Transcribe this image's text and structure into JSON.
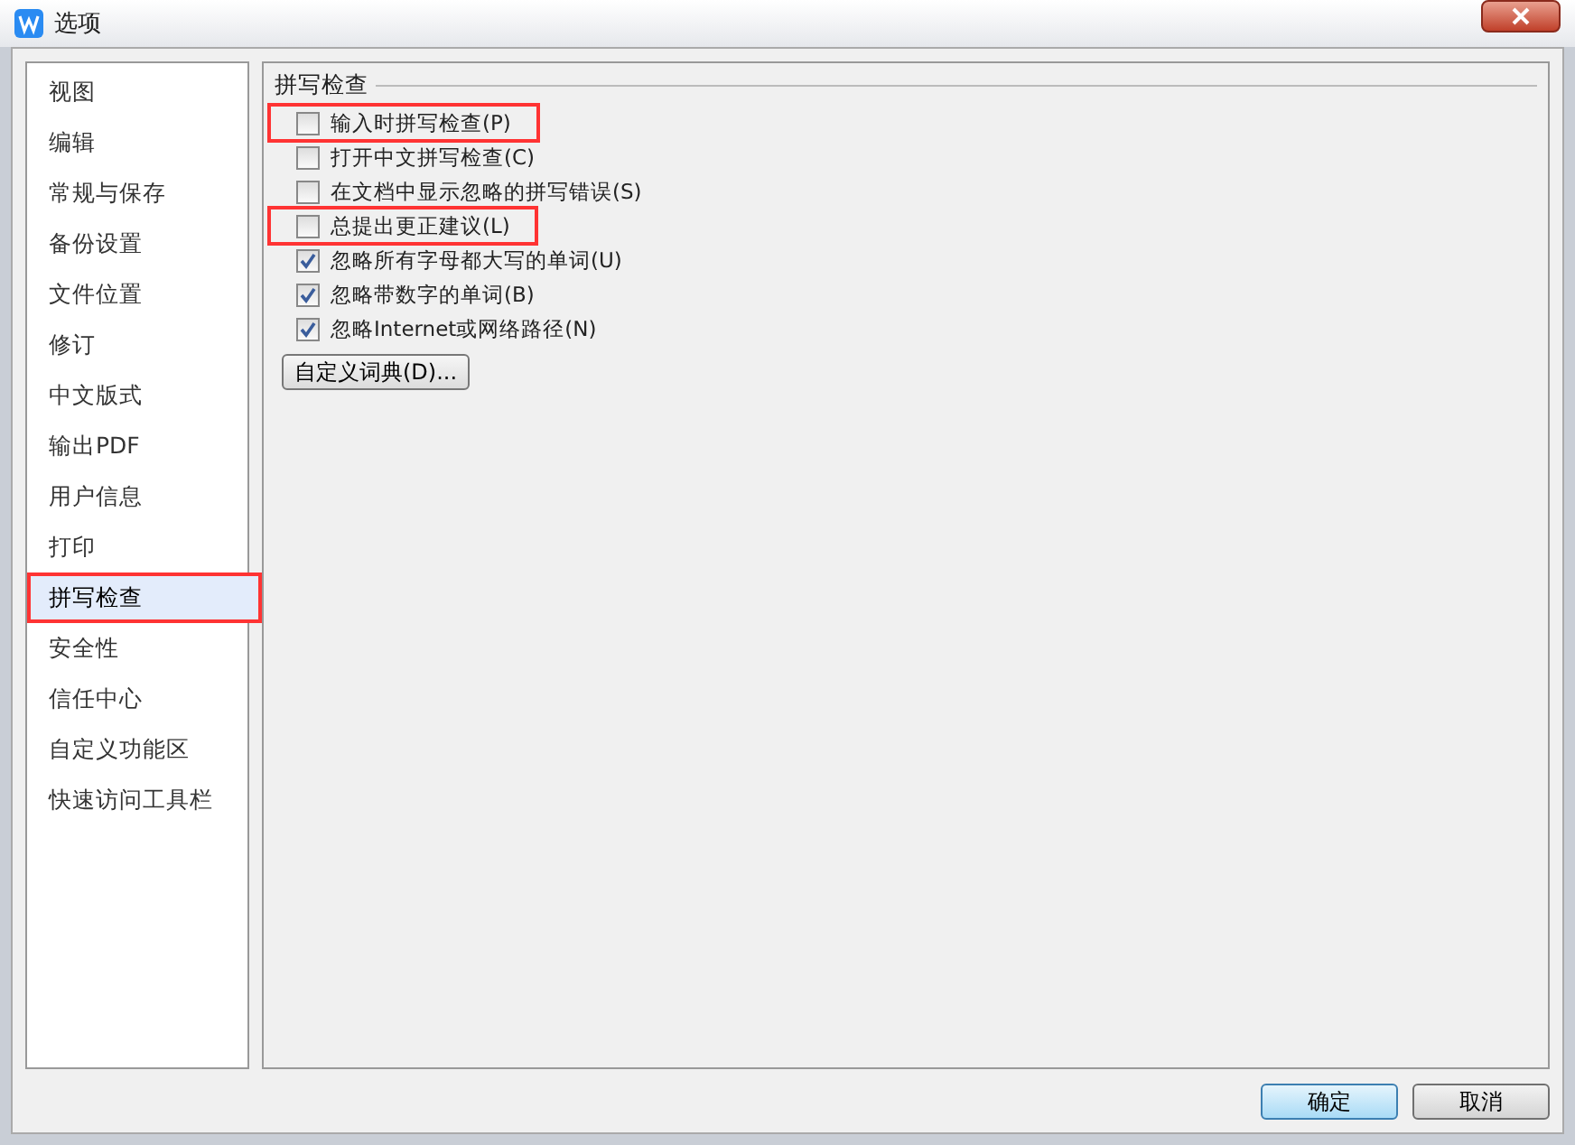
{
  "window": {
    "title": "选项"
  },
  "sidebar": {
    "items": [
      {
        "label": "视图",
        "selected": false,
        "marked": false
      },
      {
        "label": "编辑",
        "selected": false,
        "marked": false
      },
      {
        "label": "常规与保存",
        "selected": false,
        "marked": false
      },
      {
        "label": "备份设置",
        "selected": false,
        "marked": false
      },
      {
        "label": "文件位置",
        "selected": false,
        "marked": false
      },
      {
        "label": "修订",
        "selected": false,
        "marked": false
      },
      {
        "label": "中文版式",
        "selected": false,
        "marked": false
      },
      {
        "label": "输出PDF",
        "selected": false,
        "marked": false
      },
      {
        "label": "用户信息",
        "selected": false,
        "marked": false
      },
      {
        "label": "打印",
        "selected": false,
        "marked": false
      },
      {
        "label": "拼写检查",
        "selected": true,
        "marked": true
      },
      {
        "label": "安全性",
        "selected": false,
        "marked": false
      },
      {
        "label": "信任中心",
        "selected": false,
        "marked": false
      },
      {
        "label": "自定义功能区",
        "selected": false,
        "marked": false
      },
      {
        "label": "快速访问工具栏",
        "selected": false,
        "marked": false
      }
    ]
  },
  "panel": {
    "title": "拼写检查",
    "options": [
      {
        "label": "输入时拼写检查(P)",
        "checked": false,
        "marked": true
      },
      {
        "label": "打开中文拼写检查(C)",
        "checked": false,
        "marked": false
      },
      {
        "label": "在文档中显示忽略的拼写错误(S)",
        "checked": false,
        "marked": false
      },
      {
        "label": "总提出更正建议(L)",
        "checked": false,
        "marked": true
      },
      {
        "label": "忽略所有字母都大写的单词(U)",
        "checked": true,
        "marked": false
      },
      {
        "label": "忽略带数字的单词(B)",
        "checked": true,
        "marked": false
      },
      {
        "label": "忽略Internet或网络路径(N)",
        "checked": true,
        "marked": false
      }
    ],
    "dictionary_button": "自定义词典(D)..."
  },
  "buttons": [
    {
      "label": "确定",
      "default": true
    },
    {
      "label": "取消",
      "default": false
    }
  ]
}
